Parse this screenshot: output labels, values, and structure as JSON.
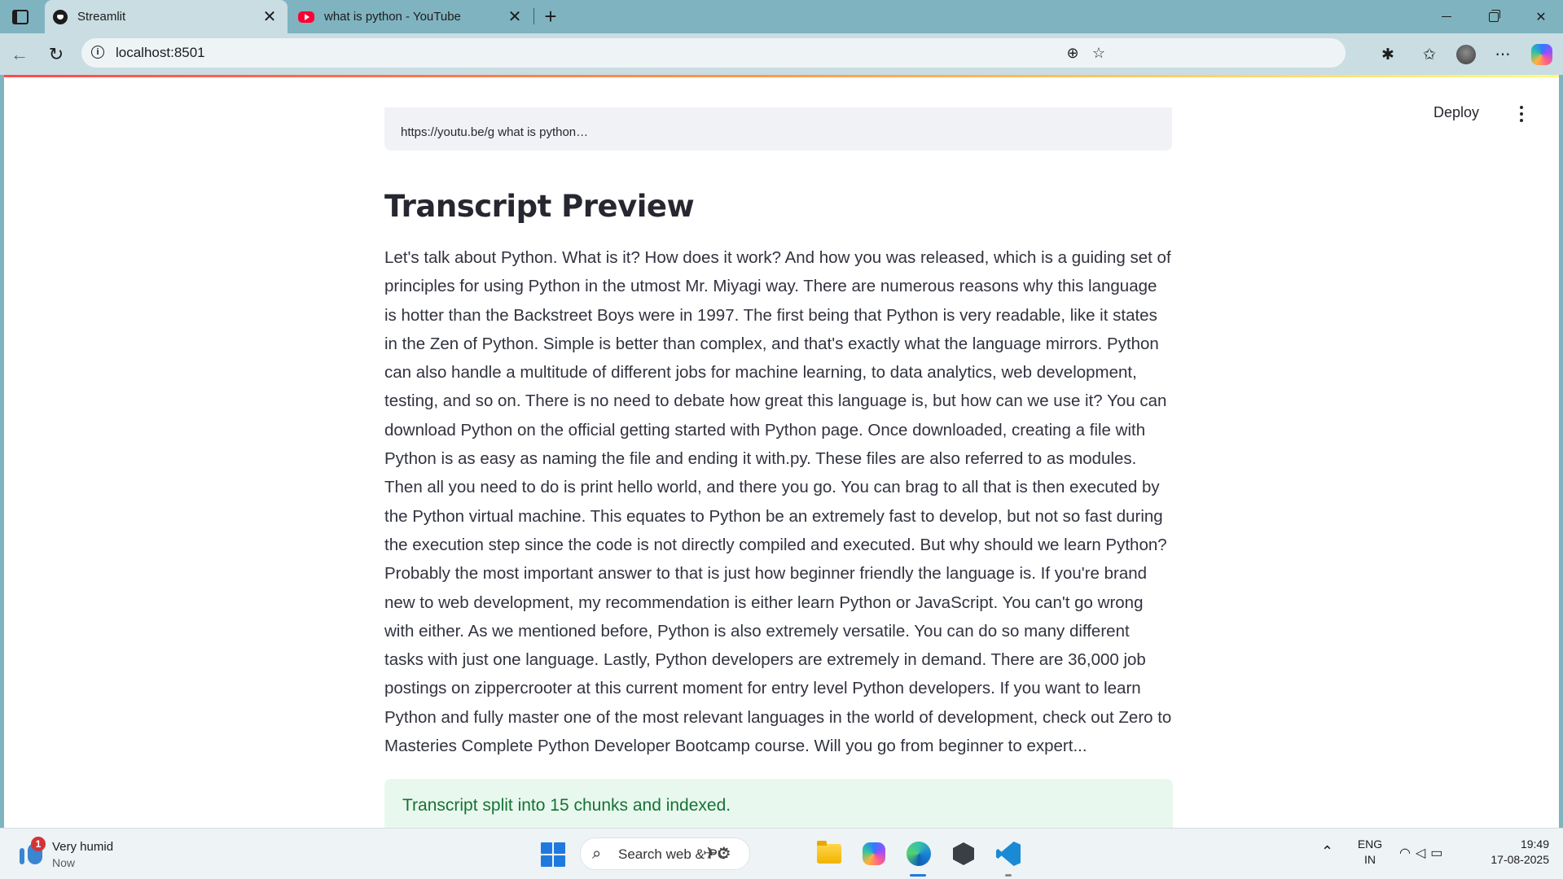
{
  "browser": {
    "tabs": [
      {
        "title": "Streamlit",
        "active": true,
        "favicon": "streamlit-icon"
      },
      {
        "title": "what is python - YouTube",
        "active": false,
        "favicon": "youtube-icon"
      }
    ],
    "close_glyph": "✕",
    "new_tab_glyph": "+",
    "url": "localhost:8501"
  },
  "app": {
    "header": {
      "deploy_label": "Deploy"
    },
    "previous_box_clip": "https://youtu.be/g  what is python…",
    "section_title": "Transcript Preview",
    "transcript": "Let's talk about Python. What is it? How does it work? And how you was released, which is a guiding set of principles for using Python in the utmost Mr. Miyagi way. There are numerous reasons why this language is hotter than the Backstreet Boys were in 1997. The first being that Python is very readable, like it states in the Zen of Python. Simple is better than complex, and that's exactly what the language mirrors. Python can also handle a multitude of different jobs for machine learning, to data analytics, web development, testing, and so on. There is no need to debate how great this language is, but how can we use it? You can download Python on the official getting started with Python page. Once downloaded, creating a file with Python is as easy as naming the file and ending it with.py. These files are also referred to as modules. Then all you need to do is print hello world, and there you go. You can brag to all that is then executed by the Python virtual machine. This equates to Python be an extremely fast to develop, but not so fast during the execution step since the code is not directly compiled and executed. But why should we learn Python? Probably the most important answer to that is just how beginner friendly the language is. If you're brand new to web development, my recommendation is either learn Python or JavaScript. You can't go wrong with either. As we mentioned before, Python is also extremely versatile. You can do so many different tasks with just one language. Lastly, Python developers are extremely in demand. There are 36,000 job postings on zippercrooter at this current moment for entry level Python developers. If you want to learn Python and fully master one of the most relevant languages in the world of development, check out Zero to Masteries Complete Python Developer Bootcamp course. Will you go from beginner to expert...",
    "success_message": "Transcript split into 15 chunks and indexed.",
    "colors": {
      "accent": "#ff4b4b",
      "success_bg": "#e8f8ee",
      "success_text": "#177233"
    }
  },
  "taskbar": {
    "weather": {
      "badge": "1",
      "line1": "Very humid",
      "line2": "Now"
    },
    "search_placeholder": "Search web & PC",
    "lang_line1": "ENG",
    "lang_line2": "IN",
    "time": "19:49",
    "date": "17-08-2025"
  }
}
